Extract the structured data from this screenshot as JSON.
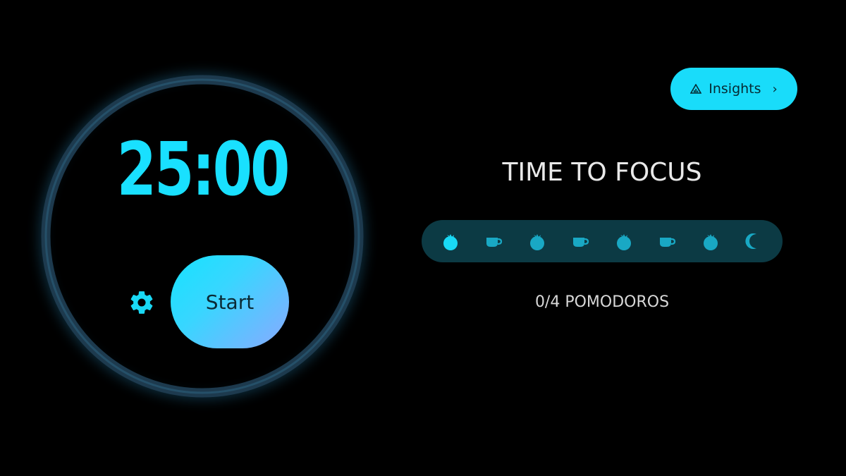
{
  "timer": {
    "display": "25:00",
    "start_label": "Start"
  },
  "icons": {
    "settings": "gear-icon",
    "insights": "chart-icon",
    "chevron": "chevron-right-icon",
    "session_sequence": [
      "tomato-icon",
      "cup-icon",
      "tomato-icon",
      "cup-icon",
      "tomato-icon",
      "cup-icon",
      "tomato-icon",
      "moon-icon"
    ]
  },
  "header": {
    "insights_label": "Insights",
    "chevron_glyph": "›"
  },
  "status": {
    "title": "TIME TO FOCUS",
    "pomodoro_count": "0/4 POMODOROS",
    "completed": 0,
    "total": 4
  },
  "colors": {
    "background": "#000000",
    "accent": "#19e0ff",
    "ring": "#1d3a4e",
    "session_bar": "#0c3a44",
    "icon": "#19d9f5"
  }
}
